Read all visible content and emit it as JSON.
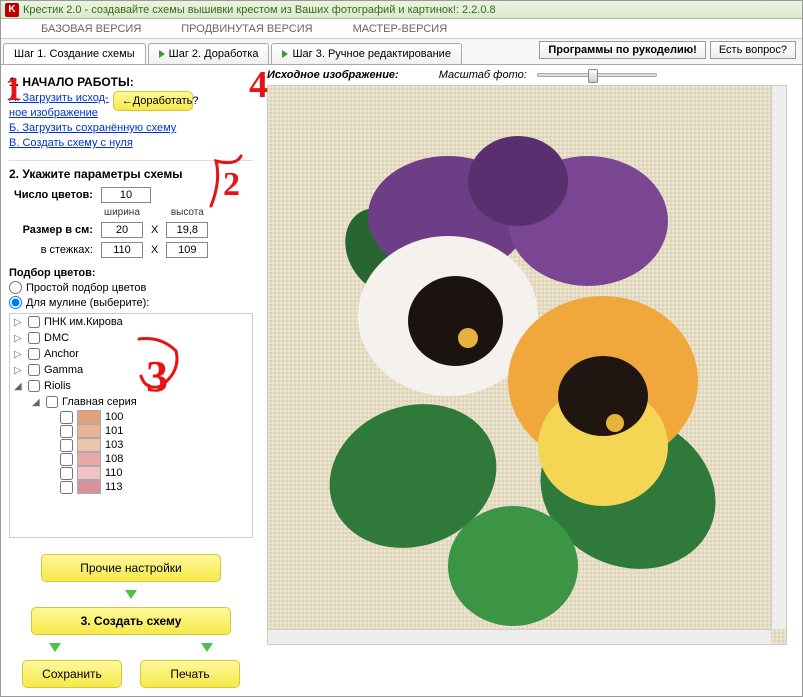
{
  "titlebar": "Крестик 2.0 - создавайте схемы вышивки крестом из Ваших фотографий и картинок!: 2.2.0.8",
  "menu": {
    "base": "БАЗОВАЯ ВЕРСИЯ",
    "adv": "ПРОДВИНУТАЯ ВЕРСИЯ",
    "master": "МАСТЕР-ВЕРСИЯ"
  },
  "tabs": {
    "step1": "Шаг 1. Создание схемы",
    "step2": "Шаг 2. Доработка",
    "step3": "Шаг 3. Ручное редактирование"
  },
  "right_buttons": {
    "programs": "Программы по рукоделию!",
    "question": "Есть вопрос?"
  },
  "left": {
    "start_hdr": "1. НАЧАЛО РАБОТЫ:",
    "link_a1": "А. Загрузить исход-",
    "link_a2": "ное изображение",
    "link_b": "Б. Загрузить сохранённую схему",
    "link_c": "В. Создать схему с нуля",
    "dorabot": "←Доработать?",
    "params_hdr": "2. Укажите параметры схемы",
    "colors_label": "Число цветов:",
    "colors_value": "10",
    "size_row": "Размер в см:",
    "stitches_row": "в стежках:",
    "width_hdr": "ширина",
    "height_hdr": "высота",
    "w_cm": "20",
    "h_cm": "19,8",
    "w_st": "110",
    "h_st": "109",
    "x_sep": "X",
    "podborg": "Подбор цветов:",
    "simple": "Простой подбор цветов",
    "mouline": "Для мулине (выберите):",
    "tree": [
      {
        "name": "ПНК им.Кирова"
      },
      {
        "name": "DMC"
      },
      {
        "name": "Anchor"
      },
      {
        "name": "Gamma"
      },
      {
        "name": "Riolis",
        "expanded": true,
        "children": [
          {
            "name": "Главная серия",
            "expanded": true,
            "colors": [
              {
                "code": "100",
                "hex": "#e3a278"
              },
              {
                "code": "101",
                "hex": "#e7b494"
              },
              {
                "code": "103",
                "hex": "#ecc5ad"
              },
              {
                "code": "108",
                "hex": "#e9a9a9"
              },
              {
                "code": "110",
                "hex": "#f0c4c4"
              },
              {
                "code": "113",
                "hex": "#d9929c"
              }
            ]
          }
        ]
      }
    ],
    "other_btn": "Прочие настройки",
    "create_btn": "3. Создать схему",
    "save_btn": "Сохранить",
    "print_btn": "Печать"
  },
  "right": {
    "title": "Исходное изображение:",
    "zoom_label": "Масштаб фото:"
  },
  "annot": {
    "a1": "1",
    "a2": "2",
    "a3": "3",
    "a4": "4"
  }
}
